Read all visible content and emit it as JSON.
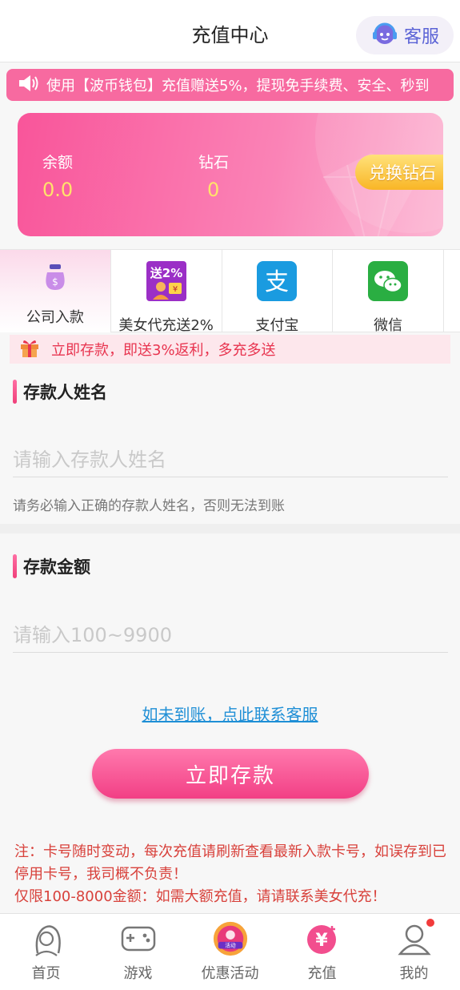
{
  "header": {
    "title": "充值中心",
    "service_label": "客服"
  },
  "notice": {
    "text": "使用【波币钱包】充值赠送5%，提现免手续费、安全、秒到"
  },
  "balance_card": {
    "balance_label": "余额",
    "balance_value": "0.0",
    "diamond_label": "钻石",
    "diamond_value": "0",
    "exchange_label": "兑换钻石"
  },
  "methods": [
    {
      "label": "公司入款",
      "icon": "money-bag-icon",
      "active": true
    },
    {
      "label": "美女代充送2%",
      "icon": "agent-2pct-icon",
      "badge": "送2%"
    },
    {
      "label": "支付宝",
      "icon": "alipay-icon"
    },
    {
      "label": "微信",
      "icon": "wechat-icon"
    }
  ],
  "promo": {
    "text": "立即存款，即送3%返利，多充多送"
  },
  "form": {
    "name_title": "存款人姓名",
    "name_placeholder": "请输入存款人姓名",
    "name_hint": "请务必输入正确的存款人姓名，否则无法到账",
    "amount_title": "存款金额",
    "amount_placeholder": "请输入100~9900"
  },
  "contact_link": "如未到账，点此联系客服",
  "deposit_button": "立即存款",
  "notes": {
    "line1": "注：卡号随时变动，每次充值请刷新查看最新入款卡号，如误存到已停用卡号，我司概不负责！",
    "line2": "仅限100-8000金额：如需大额充值，请请联系美女代充！"
  },
  "tabbar": [
    {
      "label": "首页",
      "icon": "home-avatar-icon"
    },
    {
      "label": "游戏",
      "icon": "gamepad-icon"
    },
    {
      "label": "优惠活动",
      "icon": "promotion-icon"
    },
    {
      "label": "充值",
      "icon": "recharge-icon"
    },
    {
      "label": "我的",
      "icon": "user-icon",
      "badge": true
    }
  ],
  "colors": {
    "accent": "#f23f85",
    "warning_text": "#d8413b",
    "link": "#1f8fd6"
  }
}
